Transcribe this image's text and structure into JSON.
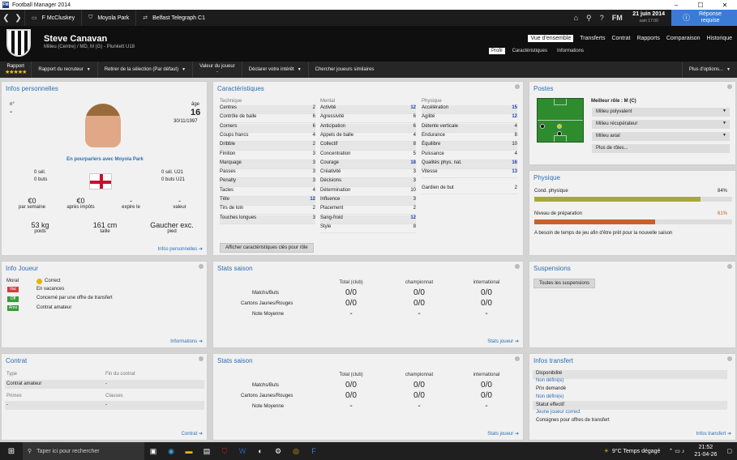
{
  "window": {
    "title": "Football Manager 2014"
  },
  "topnav": {
    "manager": "F McCluskey",
    "club": "Moyola Park",
    "competition": "Belfast Telegraph C1",
    "date": "21 juin 2014",
    "time": "sam 17:00",
    "respond": "Réponse requise",
    "fm": "FM"
  },
  "player": {
    "name": "Steve Canavan",
    "position": "Milieu (Centre) / MD, M (G) - Plunkett U18"
  },
  "tabs": [
    "Vue d'ensemble",
    "Transferts",
    "Contrat",
    "Rapports",
    "Comparaison",
    "Historique"
  ],
  "subtabs": [
    "Profil",
    "Caractéristiques",
    "Informations"
  ],
  "actionbar": {
    "rating_label": "Rapport",
    "stars": "★★★★★",
    "btn1": "Rapport du recruteur",
    "btn2": "Retirer de la sélection (Par défaut)",
    "btn3": "Valeur du joueur",
    "btn3b": "-",
    "btn4": "Déclarer votre intérêt",
    "btn5": "Chercher joueurs similaires",
    "btn6": "Plus d'options..."
  },
  "infos": {
    "title": "Infos personnelles",
    "no_label": "n°",
    "no": "-",
    "age_label": "âge",
    "age": "16",
    "dob": "30/11/1997",
    "loan": "En pourparlers avec Moyola Park",
    "sel": "0 sél.",
    "buts": "0 buts",
    "sel21": "0 sél. U21",
    "buts21": "0 buts U21",
    "wage": "€0",
    "wage_l": "par semaine",
    "after_tax": "€0",
    "after_tax_l": "après impôts",
    "expires": "-",
    "expires_l": "expire le",
    "value": "-",
    "value_l": "valeur",
    "weight": "53 kg",
    "weight_l": "poids",
    "height": "161 cm",
    "height_l": "taille",
    "foot": "Gaucher exc.",
    "foot_l": "pied",
    "link": "Infos personnelles"
  },
  "attributes": {
    "title": "Caractéristiques",
    "technique_h": "Technique",
    "mental_h": "Mental",
    "physique_h": "Physique",
    "technique": [
      [
        "Centres",
        "2"
      ],
      [
        "Contrôle de balle",
        "6"
      ],
      [
        "Corners",
        "6"
      ],
      [
        "Coups francs",
        "4"
      ],
      [
        "Dribble",
        "2"
      ],
      [
        "Finition",
        "3"
      ],
      [
        "Marquage",
        "3"
      ],
      [
        "Passes",
        "3"
      ],
      [
        "Penalty",
        "3"
      ],
      [
        "Tacles",
        "4"
      ],
      [
        "Tête",
        "12"
      ],
      [
        "Tirs de loin",
        "2"
      ],
      [
        "Touches longues",
        "3"
      ]
    ],
    "mental": [
      [
        "Activité",
        "12"
      ],
      [
        "Agressivité",
        "6"
      ],
      [
        "Anticipation",
        "6"
      ],
      [
        "Appels de balle",
        "4"
      ],
      [
        "Collectif",
        "8"
      ],
      [
        "Concentration",
        "5"
      ],
      [
        "Courage",
        "18"
      ],
      [
        "Créativité",
        "3"
      ],
      [
        "Décisions",
        "3"
      ],
      [
        "Détermination",
        "10"
      ],
      [
        "Influence",
        "3"
      ],
      [
        "Placement",
        "2"
      ],
      [
        "Sang-froid",
        "12"
      ],
      [
        "Style",
        "8"
      ]
    ],
    "physique": [
      [
        "Accélération",
        "15"
      ],
      [
        "Agilité",
        "12"
      ],
      [
        "Détente verticale",
        "4"
      ],
      [
        "Endurance",
        "8"
      ],
      [
        "Équilibre",
        "10"
      ],
      [
        "Puissance",
        "4"
      ],
      [
        "Qualités phys. nat.",
        "16"
      ],
      [
        "Vitesse",
        "13"
      ]
    ],
    "gk": [
      "Gardien de but",
      "2"
    ],
    "btn": "Afficher caractéristiques clés pour rôle"
  },
  "postes": {
    "title": "Postes",
    "best": "Meilleur rôle : M (C)",
    "roles": [
      "Milieu polyvalent",
      "Milieu récupérateur",
      "Milieu axial",
      "Plus de rôles..."
    ]
  },
  "physique": {
    "title": "Physique",
    "cond_l": "Cond. physique",
    "cond": "84%",
    "cond_v": 0.84,
    "prep_l": "Niveau de préparation",
    "prep": "61%",
    "prep_v": 0.61,
    "note": "A besoin de temps de jeu afin d'être prêt pour la nouvelle saison"
  },
  "infojoueur": {
    "title": "Info Joueur",
    "moral_l": "Moral",
    "moral": "Correct",
    "vac": "Vac",
    "vac_t": "En vacances",
    "off": "Off",
    "off_t": "Concerné par une offre de transfert",
    "ama": "Ama",
    "ama_t": "Contrat amateur",
    "link": "Informations"
  },
  "stats": {
    "title": "Stats saison",
    "cols": [
      "Total (club)",
      "championnat",
      "international"
    ],
    "rows": [
      [
        "Matchs/Buts",
        "0/0",
        "0/0",
        "0/0"
      ],
      [
        "Cartons Jaunes/Rouges",
        "0/0",
        "0/0",
        "0/0"
      ],
      [
        "Note Moyenne",
        "-",
        "-",
        "-"
      ]
    ],
    "link": "Stats joueur"
  },
  "suspensions": {
    "title": "Suspensions",
    "btn": "Toutes les suspensions"
  },
  "contrat": {
    "title": "Contrat",
    "type_l": "Type",
    "type": "Contrat amateur",
    "end_l": "Fin du contrat",
    "end": "-",
    "primes_l": "Primes",
    "primes": "-",
    "clauses_l": "Clauses",
    "clauses": "-",
    "link": "Contrat"
  },
  "transfert": {
    "title": "Infos transfert",
    "rows": [
      [
        "Disponibilité",
        "Non défini(e)"
      ],
      [
        "Prix demandé",
        "Non défini(e)"
      ],
      [
        "Statut effectif",
        "Jeune joueur correct"
      ],
      [
        "Consignes pour offres de transfert",
        ""
      ]
    ],
    "link": "Infos transfert"
  },
  "taskbar": {
    "search": "Taper ici pour rechercher",
    "weather": "9°C  Temps dégagé",
    "time": "21:52",
    "date": "21-04-26"
  }
}
